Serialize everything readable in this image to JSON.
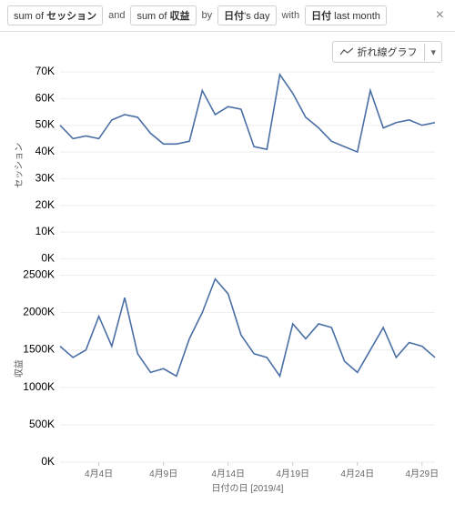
{
  "query": {
    "pill1_prefix": "sum of ",
    "pill1_bold": "セッション",
    "conj1": "and",
    "pill2_prefix": "sum of ",
    "pill2_bold": "収益",
    "conj2": "by",
    "pill3_bold": "日付",
    "pill3_suffix": "'s day",
    "conj3": "with",
    "pill4_bold": "日付",
    "pill4_suffix": " last month"
  },
  "chart_selector": {
    "label": "折れ線グラフ"
  },
  "chart_data": [
    {
      "type": "line",
      "ylabel": "セッション",
      "ylim": [
        0,
        70000
      ],
      "yticks": [
        0,
        10000,
        20000,
        30000,
        40000,
        50000,
        60000,
        70000
      ],
      "ytick_labels": [
        "0K",
        "10K",
        "20K",
        "30K",
        "40K",
        "50K",
        "60K",
        "70K"
      ],
      "x": [
        1,
        2,
        3,
        4,
        5,
        6,
        7,
        8,
        9,
        10,
        11,
        12,
        13,
        14,
        15,
        16,
        17,
        18,
        19,
        20,
        21,
        22,
        23,
        24,
        25,
        26,
        27,
        28,
        29,
        30
      ],
      "values": [
        50000,
        45000,
        46000,
        45000,
        52000,
        54000,
        53000,
        47000,
        43000,
        43000,
        44000,
        63000,
        54000,
        57000,
        56000,
        42000,
        41000,
        69000,
        62000,
        53000,
        49000,
        44000,
        42000,
        40000,
        63000,
        49000,
        51000,
        52000,
        50000,
        51000
      ],
      "color": "#4a6fa5"
    },
    {
      "type": "line",
      "ylabel": "収益",
      "ylim": [
        0,
        2500000
      ],
      "yticks": [
        0,
        500000,
        1000000,
        1500000,
        2000000,
        2500000
      ],
      "ytick_labels": [
        "0K",
        "500K",
        "1000K",
        "1500K",
        "2000K",
        "2500K"
      ],
      "x": [
        1,
        2,
        3,
        4,
        5,
        6,
        7,
        8,
        9,
        10,
        11,
        12,
        13,
        14,
        15,
        16,
        17,
        18,
        19,
        20,
        21,
        22,
        23,
        24,
        25,
        26,
        27,
        28,
        29,
        30
      ],
      "values": [
        1550000,
        1400000,
        1500000,
        1950000,
        1550000,
        2200000,
        1450000,
        1200000,
        1250000,
        1150000,
        1650000,
        2000000,
        2450000,
        2250000,
        1700000,
        1450000,
        1400000,
        1150000,
        1850000,
        1650000,
        1850000,
        1800000,
        1350000,
        1200000,
        1500000,
        1800000,
        1400000,
        1600000,
        1550000,
        1400000
      ],
      "color": "#4a6fa5"
    }
  ],
  "xaxis": {
    "ticks": [
      4,
      9,
      14,
      19,
      24,
      29
    ],
    "tick_labels": [
      "4月4日",
      "4月9日",
      "4月14日",
      "4月19日",
      "4月24日",
      "4月29日"
    ],
    "title": "日付の日 [2019/4]"
  }
}
